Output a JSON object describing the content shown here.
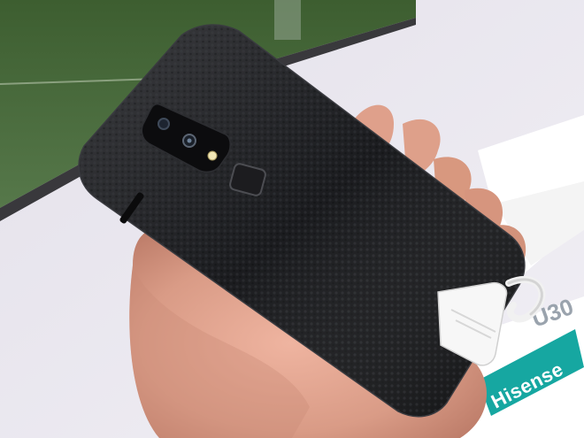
{
  "photo": {
    "subject": "smartphone-back-in-hand",
    "display_card": {
      "brand": "Hisense",
      "partial_text": "U30"
    },
    "colors": {
      "phone_body": "#17181a",
      "leather_texture": "#222326",
      "skin": "#d99b86",
      "card_accent": "#16a7a1",
      "background_wall": "#e9e7ee",
      "grass": "#4a6b3a"
    }
  }
}
